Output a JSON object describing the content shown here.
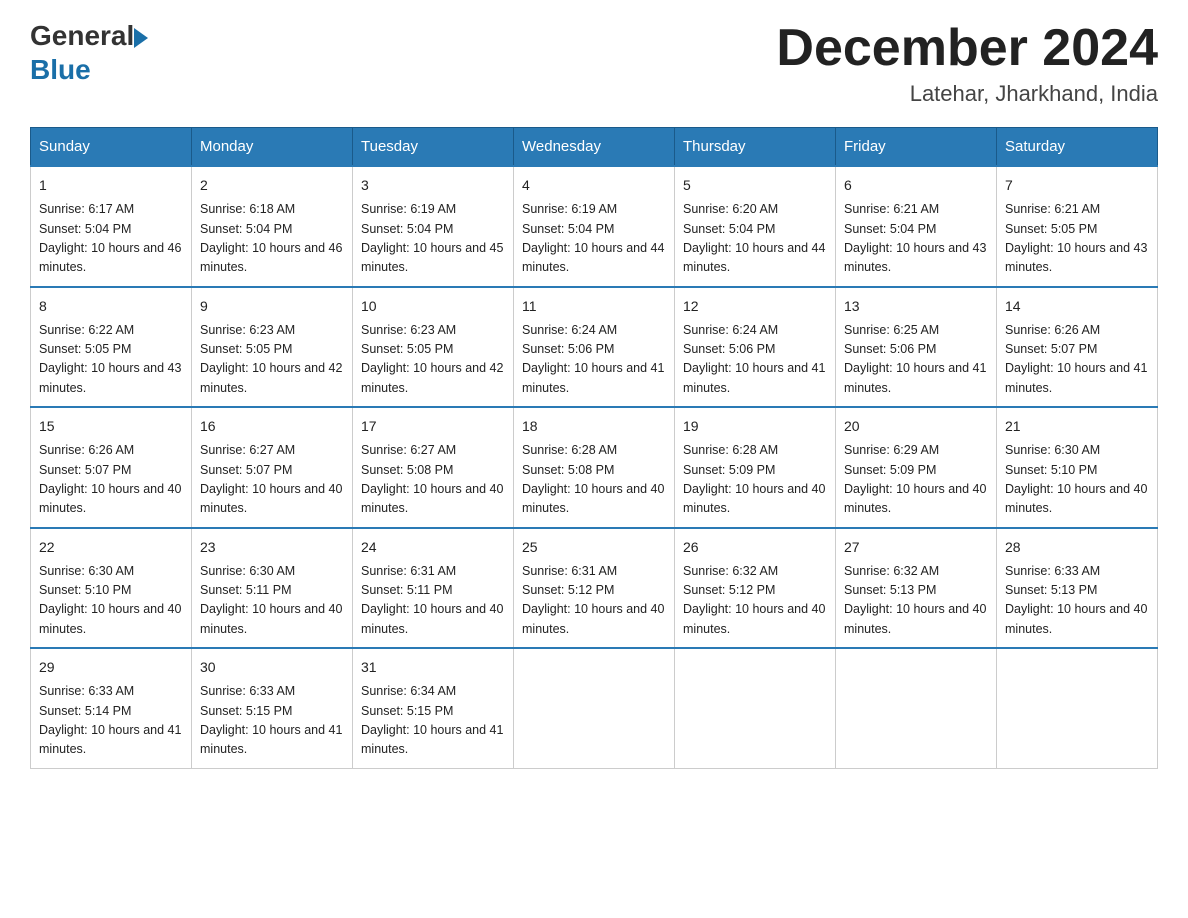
{
  "header": {
    "logo_text_general": "General",
    "logo_text_blue": "Blue",
    "month_title": "December 2024",
    "location": "Latehar, Jharkhand, India"
  },
  "days_of_week": [
    "Sunday",
    "Monday",
    "Tuesday",
    "Wednesday",
    "Thursday",
    "Friday",
    "Saturday"
  ],
  "weeks": [
    [
      {
        "day": "1",
        "sunrise": "6:17 AM",
        "sunset": "5:04 PM",
        "daylight": "10 hours and 46 minutes."
      },
      {
        "day": "2",
        "sunrise": "6:18 AM",
        "sunset": "5:04 PM",
        "daylight": "10 hours and 46 minutes."
      },
      {
        "day": "3",
        "sunrise": "6:19 AM",
        "sunset": "5:04 PM",
        "daylight": "10 hours and 45 minutes."
      },
      {
        "day": "4",
        "sunrise": "6:19 AM",
        "sunset": "5:04 PM",
        "daylight": "10 hours and 44 minutes."
      },
      {
        "day": "5",
        "sunrise": "6:20 AM",
        "sunset": "5:04 PM",
        "daylight": "10 hours and 44 minutes."
      },
      {
        "day": "6",
        "sunrise": "6:21 AM",
        "sunset": "5:04 PM",
        "daylight": "10 hours and 43 minutes."
      },
      {
        "day": "7",
        "sunrise": "6:21 AM",
        "sunset": "5:05 PM",
        "daylight": "10 hours and 43 minutes."
      }
    ],
    [
      {
        "day": "8",
        "sunrise": "6:22 AM",
        "sunset": "5:05 PM",
        "daylight": "10 hours and 43 minutes."
      },
      {
        "day": "9",
        "sunrise": "6:23 AM",
        "sunset": "5:05 PM",
        "daylight": "10 hours and 42 minutes."
      },
      {
        "day": "10",
        "sunrise": "6:23 AM",
        "sunset": "5:05 PM",
        "daylight": "10 hours and 42 minutes."
      },
      {
        "day": "11",
        "sunrise": "6:24 AM",
        "sunset": "5:06 PM",
        "daylight": "10 hours and 41 minutes."
      },
      {
        "day": "12",
        "sunrise": "6:24 AM",
        "sunset": "5:06 PM",
        "daylight": "10 hours and 41 minutes."
      },
      {
        "day": "13",
        "sunrise": "6:25 AM",
        "sunset": "5:06 PM",
        "daylight": "10 hours and 41 minutes."
      },
      {
        "day": "14",
        "sunrise": "6:26 AM",
        "sunset": "5:07 PM",
        "daylight": "10 hours and 41 minutes."
      }
    ],
    [
      {
        "day": "15",
        "sunrise": "6:26 AM",
        "sunset": "5:07 PM",
        "daylight": "10 hours and 40 minutes."
      },
      {
        "day": "16",
        "sunrise": "6:27 AM",
        "sunset": "5:07 PM",
        "daylight": "10 hours and 40 minutes."
      },
      {
        "day": "17",
        "sunrise": "6:27 AM",
        "sunset": "5:08 PM",
        "daylight": "10 hours and 40 minutes."
      },
      {
        "day": "18",
        "sunrise": "6:28 AM",
        "sunset": "5:08 PM",
        "daylight": "10 hours and 40 minutes."
      },
      {
        "day": "19",
        "sunrise": "6:28 AM",
        "sunset": "5:09 PM",
        "daylight": "10 hours and 40 minutes."
      },
      {
        "day": "20",
        "sunrise": "6:29 AM",
        "sunset": "5:09 PM",
        "daylight": "10 hours and 40 minutes."
      },
      {
        "day": "21",
        "sunrise": "6:30 AM",
        "sunset": "5:10 PM",
        "daylight": "10 hours and 40 minutes."
      }
    ],
    [
      {
        "day": "22",
        "sunrise": "6:30 AM",
        "sunset": "5:10 PM",
        "daylight": "10 hours and 40 minutes."
      },
      {
        "day": "23",
        "sunrise": "6:30 AM",
        "sunset": "5:11 PM",
        "daylight": "10 hours and 40 minutes."
      },
      {
        "day": "24",
        "sunrise": "6:31 AM",
        "sunset": "5:11 PM",
        "daylight": "10 hours and 40 minutes."
      },
      {
        "day": "25",
        "sunrise": "6:31 AM",
        "sunset": "5:12 PM",
        "daylight": "10 hours and 40 minutes."
      },
      {
        "day": "26",
        "sunrise": "6:32 AM",
        "sunset": "5:12 PM",
        "daylight": "10 hours and 40 minutes."
      },
      {
        "day": "27",
        "sunrise": "6:32 AM",
        "sunset": "5:13 PM",
        "daylight": "10 hours and 40 minutes."
      },
      {
        "day": "28",
        "sunrise": "6:33 AM",
        "sunset": "5:13 PM",
        "daylight": "10 hours and 40 minutes."
      }
    ],
    [
      {
        "day": "29",
        "sunrise": "6:33 AM",
        "sunset": "5:14 PM",
        "daylight": "10 hours and 41 minutes."
      },
      {
        "day": "30",
        "sunrise": "6:33 AM",
        "sunset": "5:15 PM",
        "daylight": "10 hours and 41 minutes."
      },
      {
        "day": "31",
        "sunrise": "6:34 AM",
        "sunset": "5:15 PM",
        "daylight": "10 hours and 41 minutes."
      },
      null,
      null,
      null,
      null
    ]
  ]
}
